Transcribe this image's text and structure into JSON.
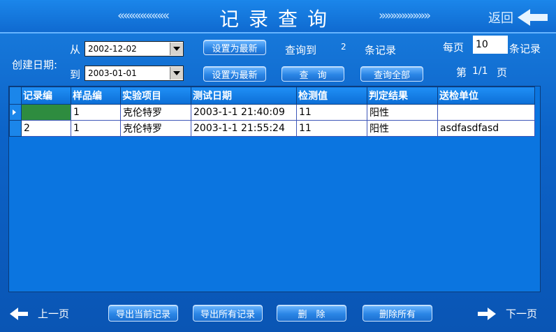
{
  "header": {
    "title": "记录查询",
    "chevrons_left": "«««««««««",
    "chevrons_right": "»»»»»»»»»",
    "back_label": "返回"
  },
  "filter": {
    "create_date_label": "创建日期:",
    "from_label": "从",
    "to_label": "到",
    "from_date": "2002-12-02",
    "to_date": "2003-01-01",
    "set_latest_label": "设置为最新",
    "query_count_prefix": "查询到",
    "query_count": "2",
    "query_count_suffix": "条记录",
    "per_page_label": "每页",
    "per_page_value": "10",
    "per_page_suffix": "条记录",
    "page_prefix": "第",
    "page_value": "1/1",
    "page_suffix": "页",
    "query_button": "查　询",
    "query_all_button": "查询全部"
  },
  "table": {
    "columns": [
      "记录编",
      "样品编",
      "实验项目",
      "测试日期",
      "检测值",
      "判定结果",
      "送检单位"
    ],
    "rows": [
      [
        "",
        "1",
        "克伦特罗",
        "2003-1-1 21:40:09",
        "11",
        "阳性",
        ""
      ],
      [
        "2",
        "1",
        "克伦特罗",
        "2003-1-1 21:55:24",
        "11",
        "阳性",
        "asdfasdfasd"
      ]
    ]
  },
  "footer": {
    "prev_label": "上一页",
    "next_label": "下一页",
    "export_current": "导出当前记录",
    "export_all": "导出所有记录",
    "delete": "删　除",
    "delete_all": "删除所有"
  }
}
